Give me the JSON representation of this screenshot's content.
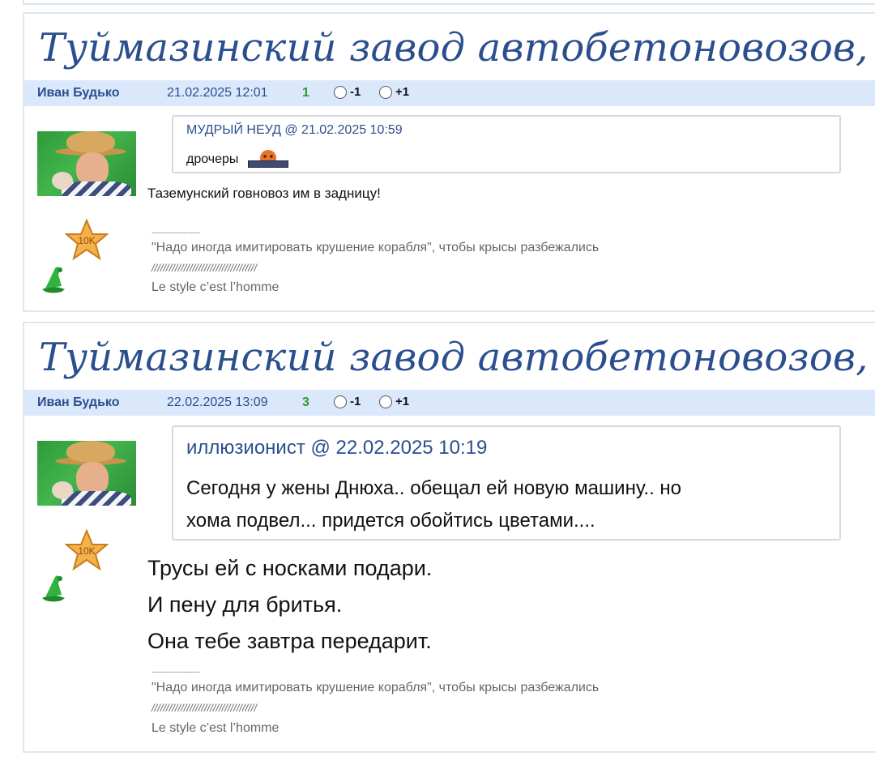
{
  "posts": [
    {
      "title": "Туймазинский завод автобетоновозов, ТЗА",
      "author": "Иван Будько",
      "date": "21.02.2025 12:01",
      "score": "1",
      "vote_minus": "-1",
      "vote_plus": "+1",
      "quote_header": "МУДРЫЙ НЕУД @ 21.02.2025 10:59",
      "quote_text": "дрочеры",
      "quote_emoticon": "censored-icon",
      "message": [
        "Таземунский говновоз им в задницу!"
      ],
      "badge": "10K",
      "signature": {
        "divider": "--------------------",
        "quote": "\"Надо иногда имитировать крушение корабля\", чтобы крысы разбежались",
        "slashes": "////////////////////////////////////",
        "motto": "Le style c’est l’homme"
      }
    },
    {
      "title": "Туймазинский завод автобетоновозов, ТЗА",
      "author": "Иван Будько",
      "date": "22.02.2025 13:09",
      "score": "3",
      "vote_minus": "-1",
      "vote_plus": "+1",
      "quote_header": "иллюзионист @ 22.02.2025 10:19",
      "quote_text": [
        "Сегодня у жены Днюха.. обещал ей новую машину.. но",
        "хома подвел... придется обойтись цветами...."
      ],
      "message": [
        "Трусы ей с носками подари.",
        "И пену для бритья.",
        "Она тебе завтра передарит."
      ],
      "badge": "10K",
      "signature": {
        "divider": "--------------------",
        "quote": "\"Надо иногда имитировать крушение корабля\", чтобы крысы разбежались",
        "slashes": "////////////////////////////////////",
        "motto": "Le style c’est l’homme"
      }
    }
  ],
  "colors": {
    "title": "#2b4f8e",
    "meta_bg": "#dbe8fb",
    "score": "#2e9a2e",
    "border": "#dfe6ee"
  }
}
